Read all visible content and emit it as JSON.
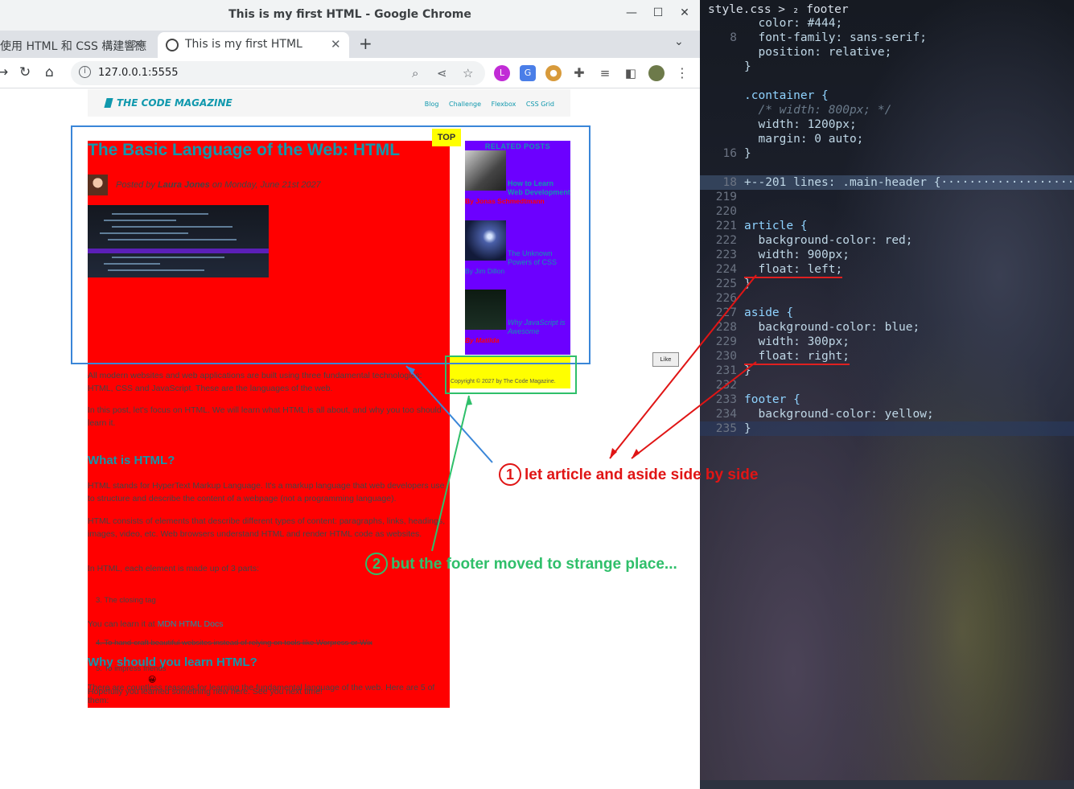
{
  "window": {
    "title": "This is my first HTML - Google Chrome",
    "tabs": [
      {
        "label": "使用 HTML 和 CSS 構建響應"
      },
      {
        "label": "This is my first HTML"
      }
    ],
    "url": "127.0.0.1:5555"
  },
  "page": {
    "logo": "THE CODE MAGAZINE",
    "nav": [
      "Blog",
      "Challenge",
      "Flexbox",
      "CSS Grid"
    ],
    "top_badge": "TOP",
    "article": {
      "title": "The Basic Language of the Web: HTML",
      "byline_pre": "Posted by ",
      "author": "Laura Jones",
      "byline_post": " on Monday, June 21st 2027",
      "p1": "All modern websites and web applications are built using three fundamental technologies: HTML, CSS and JavaScript. These are the languages of the web.",
      "p2": "In this post, let's focus on HTML. We will learn what HTML is all about, and why you too should learn it.",
      "h2_1": "What is HTML?",
      "p3": "HTML stands for HyperText Markup Language. It's a markup language that web developers use to structure and describe the content of a webpage (not a programming language).",
      "p4": "HTML consists of elements that describe different types of content: paragraphs, links, headings, images, video, etc. Web browsers understand HTML and render HTML code as websites.",
      "p5": "In HTML, each element is made up of 3 parts:",
      "li_closing": "3. The closing tag",
      "learn_pre": "You can learn it at ",
      "learn_link": "MDN HTML Docs",
      "h2_2": "Why should you learn HTML?",
      "p6": "There are countless reasons for learning the fundamental language of the web. Here are 5 of them:",
      "li_4": "4.  To hand-craft beautiful websites instead of relying on tools like Worpress or Wix",
      "li_5": "5.  To impress friends",
      "emoji": "😀",
      "closing": "Hopefully you learned something new here. See you next time!"
    },
    "aside": {
      "header": "RELATED POSTS",
      "posts": [
        {
          "title": "How to Learn Web Development",
          "by": "By Jonas Schmedtmann"
        },
        {
          "title": "The Unknown Powers of CSS",
          "by": "By Jim Dillon"
        },
        {
          "title": "Why JavaScript is Awesome",
          "by": "By Matilda"
        }
      ]
    },
    "footer": "Copyright © 2027 by The Code Magazine.",
    "like": "Like"
  },
  "editor": {
    "breadcrumb": "style.css > ₂ footer",
    "lines": [
      {
        "n": "",
        "t": "  color: #444;"
      },
      {
        "n": "8",
        "t": "  font-family: sans-serif;"
      },
      {
        "n": "",
        "t": "  position: relative;"
      },
      {
        "n": "",
        "t": "}"
      },
      {
        "n": "",
        "t": ""
      },
      {
        "n": "",
        "t": ".container {"
      },
      {
        "n": "",
        "t": "  /* width: 800px; */"
      },
      {
        "n": "",
        "t": "  width: 1200px;"
      },
      {
        "n": "",
        "t": "  margin: 0 auto;"
      },
      {
        "n": "16",
        "t": "}"
      },
      {
        "n": "",
        "t": ""
      },
      {
        "n": "18",
        "t": "+--201 lines: .main-header {···················"
      },
      {
        "n": "219",
        "t": ""
      },
      {
        "n": "220",
        "t": ""
      },
      {
        "n": "221",
        "t": "article {"
      },
      {
        "n": "222",
        "t": "  background-color: red;"
      },
      {
        "n": "223",
        "t": "  width: 900px;"
      },
      {
        "n": "224",
        "t": "  float: left;"
      },
      {
        "n": "225",
        "t": "}"
      },
      {
        "n": "226",
        "t": ""
      },
      {
        "n": "227",
        "t": "aside {"
      },
      {
        "n": "228",
        "t": "  background-color: blue;"
      },
      {
        "n": "229",
        "t": "  width: 300px;"
      },
      {
        "n": "230",
        "t": "  float: right;"
      },
      {
        "n": "231",
        "t": "}"
      },
      {
        "n": "232",
        "t": ""
      },
      {
        "n": "233",
        "t": "footer {"
      },
      {
        "n": "234",
        "t": "  background-color: yellow;"
      },
      {
        "n": "235",
        "t": "}"
      }
    ]
  },
  "annotations": {
    "a1_num": "1",
    "a1_text": "let article and aside side by side",
    "a2_num": "2",
    "a2_text": "but the footer moved to strange place...",
    "red": "#e01515",
    "green": "#2fbf6a",
    "blue": "#3a86d8"
  }
}
